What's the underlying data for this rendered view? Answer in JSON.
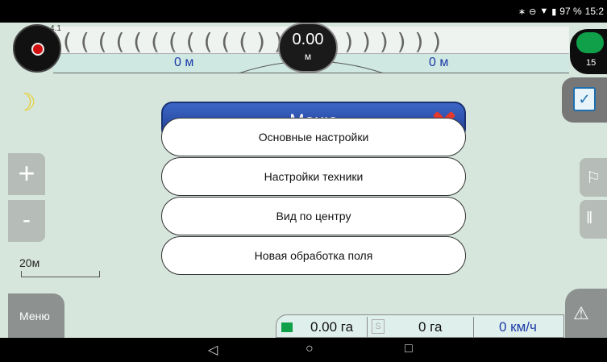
{
  "status_bar": {
    "battery": "97 %",
    "time": "15:2"
  },
  "top": {
    "compass_tag": "4.1",
    "gauge_value": "0.00",
    "gauge_unit": "м",
    "left_distance": "0 м",
    "right_distance": "0 м",
    "satellites": "15"
  },
  "map": {
    "scale_label": "20м",
    "zoom_in": "+",
    "zoom_out": "-"
  },
  "menu": {
    "title": "Меню",
    "items": [
      "Основные настройки",
      "Настройки техники",
      "Вид по центру",
      "Новая обработка поля"
    ]
  },
  "bottom": {
    "menu_button": "Меню",
    "area_value": "0.00 га",
    "s_label": "S",
    "second_area": "0 га",
    "speed": "0 км/ч"
  },
  "nav": {
    "back": "◁",
    "home": "○",
    "recents": "□"
  }
}
